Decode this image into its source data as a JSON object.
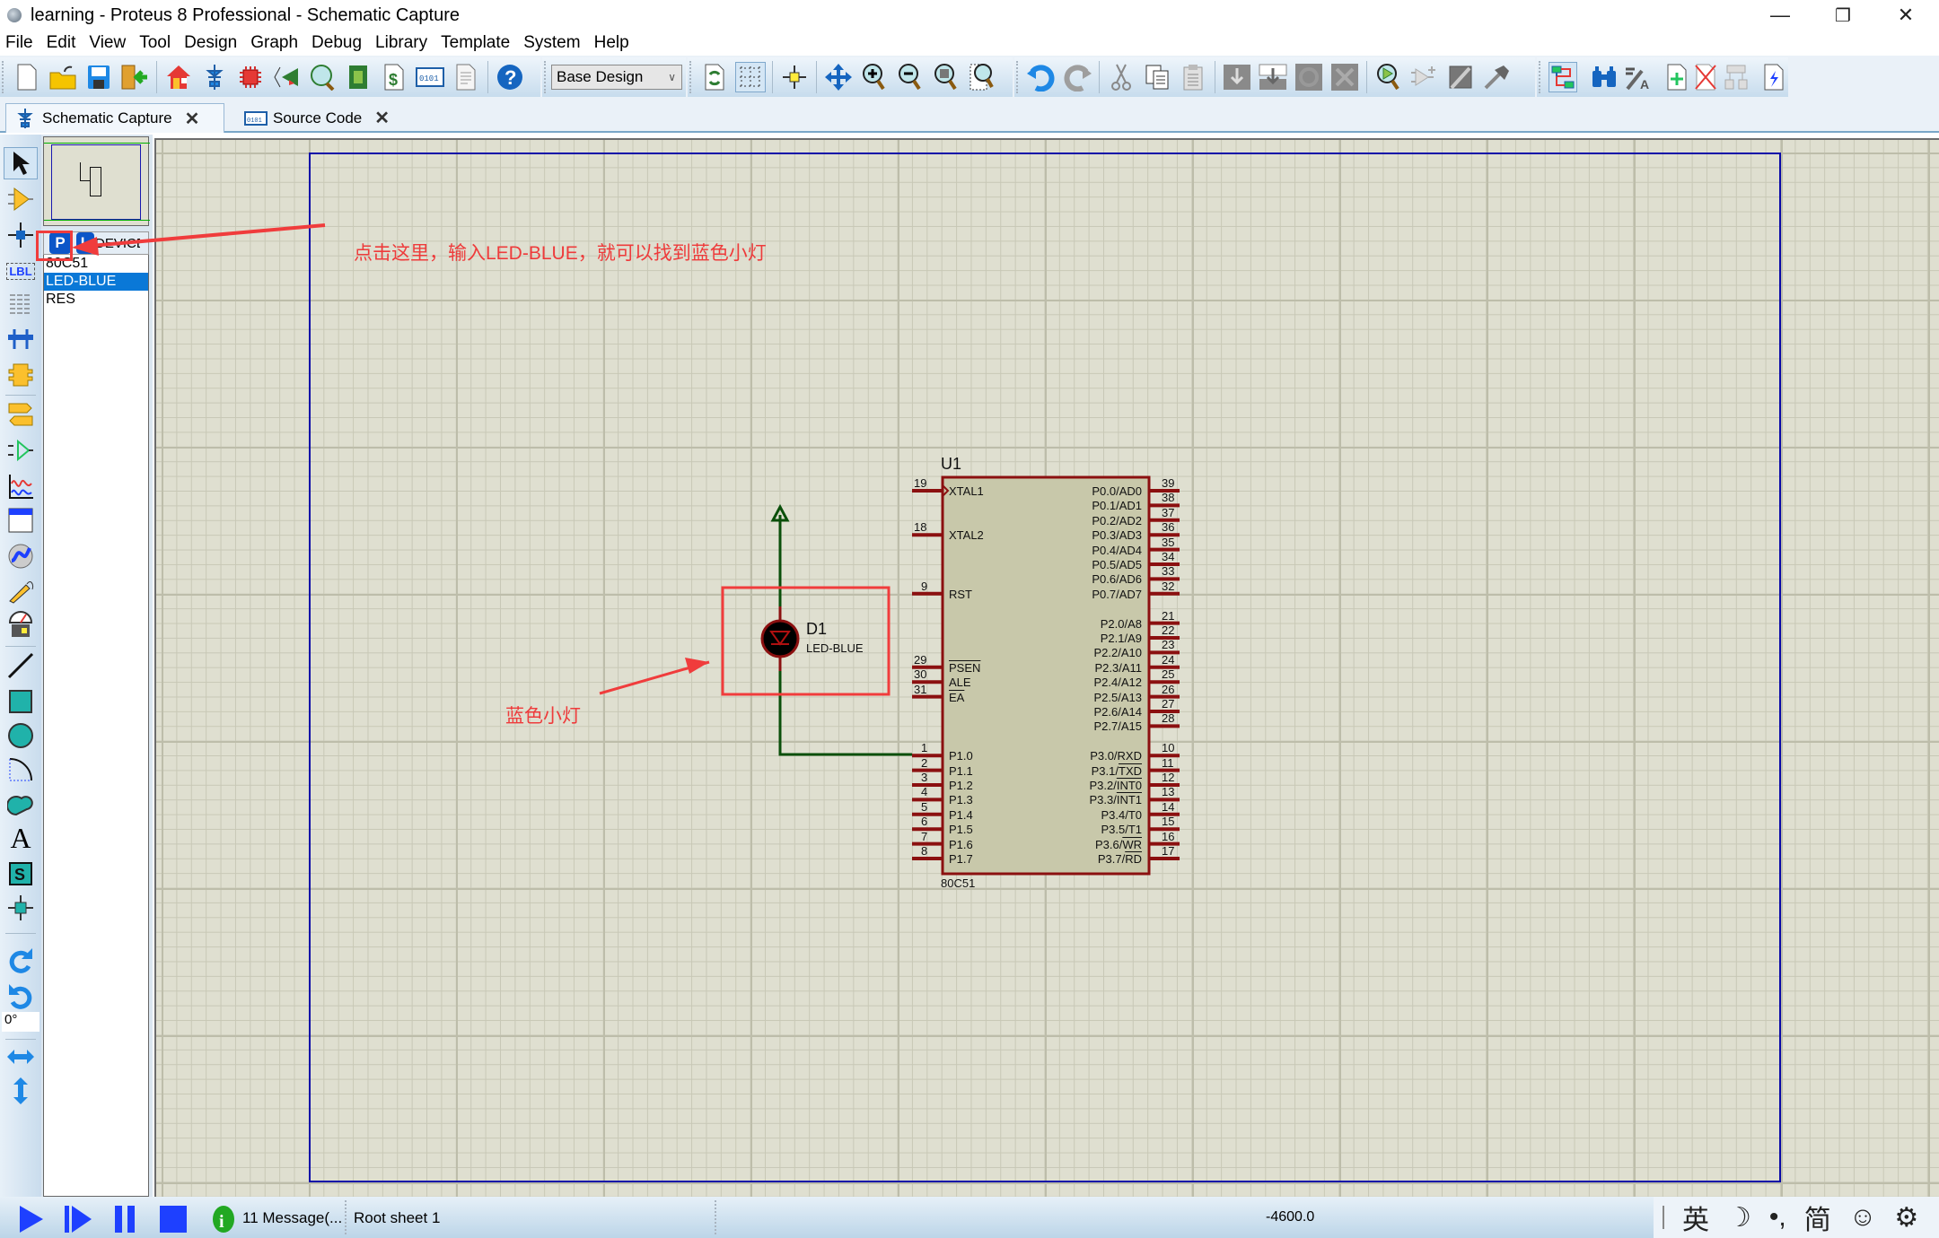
{
  "window": {
    "title": "learning - Proteus 8 Professional - Schematic Capture",
    "controls": {
      "minimize": "—",
      "restore": "❐",
      "close": "✕"
    }
  },
  "menu": [
    "File",
    "Edit",
    "View",
    "Tool",
    "Design",
    "Graph",
    "Debug",
    "Library",
    "Template",
    "System",
    "Help"
  ],
  "toolbar": {
    "variant_select": "Base Design",
    "icons": [
      "new-file",
      "open-file",
      "save",
      "import",
      "home",
      "schematic",
      "pcb-layout",
      "3d-viewer",
      "gerber-viewer",
      "design-explorer",
      "bill-of-materials",
      "source-code",
      "notes",
      "help",
      "refresh",
      "grid-toggle",
      "origin",
      "pan",
      "zoom-in",
      "zoom-out",
      "zoom-all",
      "zoom-area",
      "undo",
      "redo",
      "cut",
      "copy",
      "paste",
      "block-copy",
      "block-move",
      "block-rotate",
      "block-delete",
      "pick-device",
      "make-device",
      "packaging-tool",
      "decompose",
      "wire-autorouter",
      "search",
      "property-assignment",
      "new-sheet",
      "remove-sheet",
      "goto-child",
      "electrical-rule-check"
    ]
  },
  "tabs": [
    {
      "label": "Schematic Capture",
      "active": true
    },
    {
      "label": "Source Code",
      "active": false
    }
  ],
  "left_tools": [
    "selection",
    "component",
    "junction",
    "wire-label",
    "text-script",
    "buses",
    "subcircuit",
    "terminals",
    "device-pins",
    "graph",
    "tape-recorder",
    "generator",
    "voltage-probe",
    "virtual-instruments",
    "line-2d",
    "box-2d",
    "circle-2d",
    "arc-2d",
    "path-2d",
    "text-2d",
    "symbol-2d",
    "marker-2d",
    "rotate-clockwise",
    "rotate-anticlockwise",
    "x-mirror",
    "y-mirror"
  ],
  "rotation_value": "0°",
  "device_panel": {
    "pick_button": "P",
    "library_button": "L",
    "header": "DEVICES",
    "items": [
      {
        "name": "80C51",
        "selected": false
      },
      {
        "name": "LED-BLUE",
        "selected": true
      },
      {
        "name": "RES",
        "selected": false
      }
    ]
  },
  "schematic": {
    "chip": {
      "ref": "U1",
      "part": "80C51",
      "left_pins": [
        {
          "num": "19",
          "name": "XTAL1",
          "overline": false
        },
        {
          "num": "18",
          "name": "XTAL2",
          "overline": false
        },
        {
          "num": "9",
          "name": "RST",
          "overline": false
        },
        {
          "num": "29",
          "name": "PSEN",
          "overline": true
        },
        {
          "num": "30",
          "name": "ALE",
          "overline": false
        },
        {
          "num": "31",
          "name": "EA",
          "overline": true
        },
        {
          "num": "1",
          "name": "P1.0",
          "overline": false
        },
        {
          "num": "2",
          "name": "P1.1",
          "overline": false
        },
        {
          "num": "3",
          "name": "P1.2",
          "overline": false
        },
        {
          "num": "4",
          "name": "P1.3",
          "overline": false
        },
        {
          "num": "5",
          "name": "P1.4",
          "overline": false
        },
        {
          "num": "6",
          "name": "P1.5",
          "overline": false
        },
        {
          "num": "7",
          "name": "P1.6",
          "overline": false
        },
        {
          "num": "8",
          "name": "P1.7",
          "overline": false
        }
      ],
      "right_pins": [
        {
          "num": "39",
          "name": "P0.0/AD0"
        },
        {
          "num": "38",
          "name": "P0.1/AD1"
        },
        {
          "num": "37",
          "name": "P0.2/AD2"
        },
        {
          "num": "36",
          "name": "P0.3/AD3"
        },
        {
          "num": "35",
          "name": "P0.4/AD4"
        },
        {
          "num": "34",
          "name": "P0.5/AD5"
        },
        {
          "num": "33",
          "name": "P0.6/AD6"
        },
        {
          "num": "32",
          "name": "P0.7/AD7"
        },
        {
          "num": "21",
          "name": "P2.0/A8"
        },
        {
          "num": "22",
          "name": "P2.1/A9"
        },
        {
          "num": "23",
          "name": "P2.2/A10"
        },
        {
          "num": "24",
          "name": "P2.3/A11"
        },
        {
          "num": "25",
          "name": "P2.4/A12"
        },
        {
          "num": "26",
          "name": "P2.5/A13"
        },
        {
          "num": "27",
          "name": "P2.6/A14"
        },
        {
          "num": "28",
          "name": "P2.7/A15"
        },
        {
          "num": "10",
          "name": "P3.0/RXD"
        },
        {
          "num": "11",
          "name": "P3.1/",
          "ov": "TXD"
        },
        {
          "num": "12",
          "name": "P3.2/",
          "ov": "INT0"
        },
        {
          "num": "13",
          "name": "P3.3/",
          "ov": "INT1"
        },
        {
          "num": "14",
          "name": "P3.4/T0"
        },
        {
          "num": "15",
          "name": "P3.5/T1"
        },
        {
          "num": "16",
          "name": "P3.6/",
          "ov": "WR"
        },
        {
          "num": "17",
          "name": "P3.7/",
          "ov": "RD"
        }
      ]
    },
    "led": {
      "ref": "D1",
      "part": "LED-BLUE"
    }
  },
  "annotations": {
    "instruction": "点击这里，输入LED-BLUE，就可以找到蓝色小灯",
    "led_label": "蓝色小灯"
  },
  "status": {
    "messages": "11 Message(...",
    "sheet": "Root sheet 1",
    "coordinate": "-4600.0"
  },
  "ime": [
    "英",
    "☽",
    "•,",
    "简",
    "☺",
    "⚙"
  ]
}
